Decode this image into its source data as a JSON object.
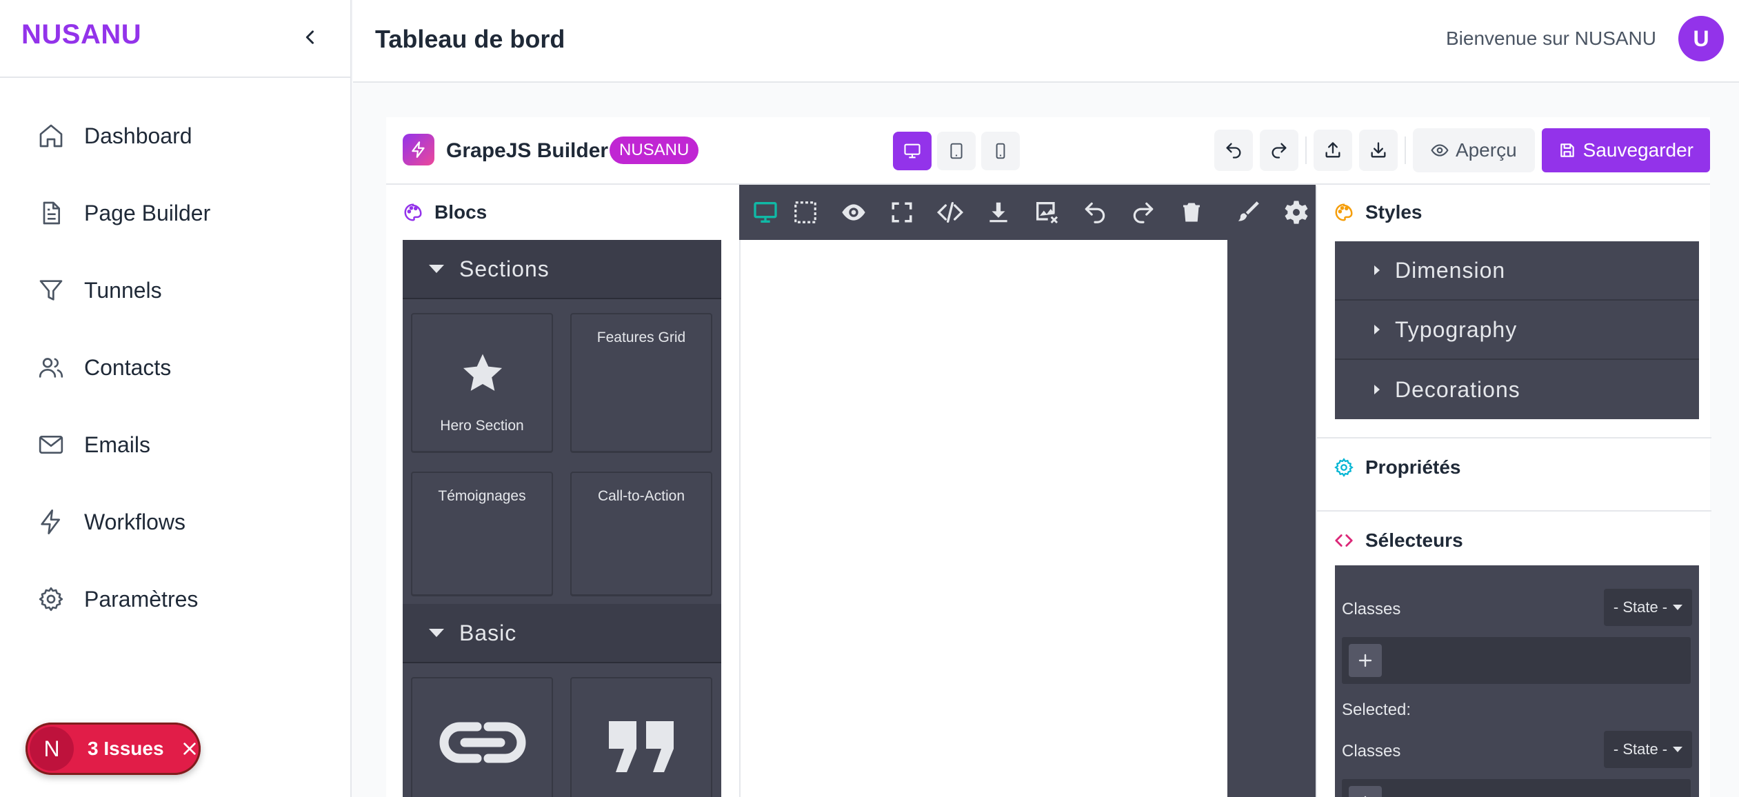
{
  "sidebar": {
    "logo": "NUSANU",
    "items": [
      {
        "label": "Dashboard",
        "icon": "home-icon"
      },
      {
        "label": "Page Builder",
        "icon": "file-text-icon"
      },
      {
        "label": "Tunnels",
        "icon": "funnel-icon"
      },
      {
        "label": "Contacts",
        "icon": "users-icon"
      },
      {
        "label": "Emails",
        "icon": "mail-icon"
      },
      {
        "label": "Workflows",
        "icon": "lightning-icon"
      },
      {
        "label": "Paramètres",
        "icon": "gear-icon"
      }
    ]
  },
  "issues": {
    "badge": "N",
    "label": "3 Issues"
  },
  "header": {
    "title": "Tableau de bord",
    "welcome": "Bienvenue sur NUSANU",
    "avatar": "U"
  },
  "builder": {
    "name": "GrapeJS Builder",
    "badge": "NUSANU",
    "preview_label": "Aperçu",
    "save_label": "Sauvegarder",
    "active_device": "desktop"
  },
  "blocks": {
    "title": "Blocs",
    "categories": [
      {
        "name": "Sections",
        "items": [
          "Hero Section",
          "Features Grid",
          "Témoignages",
          "Call-to-Action"
        ]
      },
      {
        "name": "Basic",
        "items": [
          "link-icon",
          "quote-icon"
        ]
      }
    ]
  },
  "right_panel": {
    "styles_title": "Styles",
    "style_sectors": [
      "Dimension",
      "Typography",
      "Decorations"
    ],
    "properties_title": "Propriétés",
    "selectors_title": "Sélecteurs",
    "classes_label": "Classes",
    "state_label": "- State -",
    "selected_label": "Selected:"
  },
  "colors": {
    "brand": "#9333ea",
    "gjs_dark": "#444654",
    "accent_teal": "#10b9a6",
    "issues": "#e11d48"
  }
}
